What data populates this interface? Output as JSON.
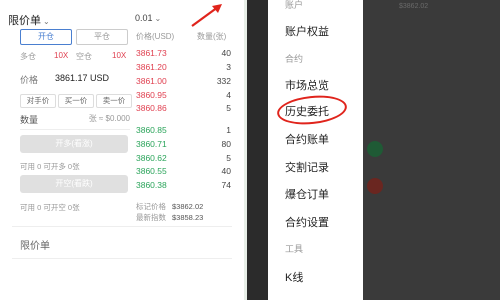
{
  "trade": {
    "order_type": "限价单",
    "leverage": "0.01",
    "tab_open": "开仓",
    "tab_close": "平仓",
    "lev": [
      {
        "label": "多仓",
        "color": "#999999"
      },
      {
        "label": "10X",
        "color": "#e04050"
      },
      {
        "label": "空仓",
        "color": "#999999"
      },
      {
        "label": "10X",
        "color": "#e04050"
      }
    ],
    "orderbook_header_price": "价格(USD)",
    "orderbook_header_qty": "数量(张)",
    "asks": [
      {
        "price": "3861.73",
        "qty": "40"
      },
      {
        "price": "3861.20",
        "qty": "3"
      },
      {
        "price": "3861.00",
        "qty": "332"
      },
      {
        "price": "3860.95",
        "qty": "4"
      },
      {
        "price": "3860.86",
        "qty": "5"
      }
    ],
    "bids": [
      {
        "price": "3860.85",
        "qty": "1"
      },
      {
        "price": "3860.71",
        "qty": "80"
      },
      {
        "price": "3860.62",
        "qty": "5"
      },
      {
        "price": "3860.55",
        "qty": "40"
      },
      {
        "price": "3860.38",
        "qty": "74"
      }
    ],
    "price_label": "价格",
    "price_value": "3861.17 USD",
    "quick_buttons": [
      "对手价",
      "买一价",
      "卖一价"
    ],
    "amount_label": "数量",
    "amount_value": "张 ≈ $0.000",
    "open_long_button": "开多(看涨)",
    "open_short_button": "开空(看跌)",
    "avail_long": "可用 0 可开多 0张",
    "avail_short": "可用 0 可开空 0张",
    "mark_price_label": "标记价格",
    "mark_price_value": "$3862.02",
    "index_price_label": "最新指数",
    "index_price_value": "$3858.23",
    "lower_title": "限价单"
  },
  "menu": {
    "top_partial": "账户",
    "items": [
      {
        "label": "账户权益"
      },
      {
        "label": "合约",
        "section": true
      },
      {
        "label": "市场总览"
      },
      {
        "label": "历史委托",
        "highlight": true
      },
      {
        "label": "合约账单"
      },
      {
        "label": "交割记录"
      },
      {
        "label": "爆仓订单"
      },
      {
        "label": "合约设置"
      },
      {
        "label": "工具",
        "section": true
      },
      {
        "label": "K线"
      }
    ],
    "highlight_color": "#e0241c"
  },
  "dimmed": {
    "top_value": "$3862.02",
    "colors": {
      "green": "#2aa45a",
      "red": "#c0392b"
    }
  }
}
